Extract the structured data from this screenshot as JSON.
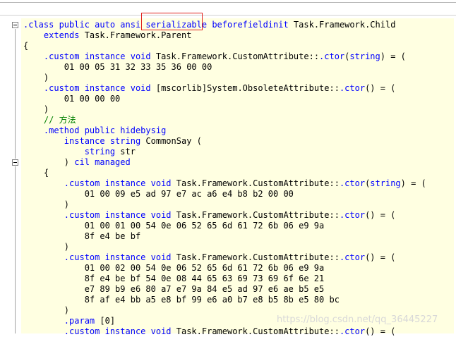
{
  "code_lines": [
    [
      {
        "t": ".class public auto ansi ",
        "c": "kw"
      },
      {
        "t": "serializable",
        "c": "kw"
      },
      {
        "t": " beforefieldinit ",
        "c": "kw"
      },
      {
        "t": "Task.Framework.Child",
        "c": "tx"
      }
    ],
    [
      {
        "t": "    ",
        "c": "tx"
      },
      {
        "t": "extends",
        "c": "kw"
      },
      {
        "t": " Task.Framework.Parent",
        "c": "tx"
      }
    ],
    [
      {
        "t": "{",
        "c": "tx"
      }
    ],
    [
      {
        "t": "    ",
        "c": "tx"
      },
      {
        "t": ".custom instance void",
        "c": "kw"
      },
      {
        "t": " Task.Framework.CustomAttribute::",
        "c": "tx"
      },
      {
        "t": ".ctor",
        "c": "kw"
      },
      {
        "t": "(",
        "c": "tx"
      },
      {
        "t": "string",
        "c": "kw"
      },
      {
        "t": ") = (",
        "c": "tx"
      }
    ],
    [
      {
        "t": "        01 00 05 31 32 33 35 36 00 00",
        "c": "tx"
      }
    ],
    [
      {
        "t": "    )",
        "c": "tx"
      }
    ],
    [
      {
        "t": "    ",
        "c": "tx"
      },
      {
        "t": ".custom instance void",
        "c": "kw"
      },
      {
        "t": " [mscorlib]System.ObsoleteAttribute::",
        "c": "tx"
      },
      {
        "t": ".ctor",
        "c": "kw"
      },
      {
        "t": "() = (",
        "c": "tx"
      }
    ],
    [
      {
        "t": "        01 00 00 00",
        "c": "tx"
      }
    ],
    [
      {
        "t": "    )",
        "c": "tx"
      }
    ],
    [
      {
        "t": "    // 方法",
        "c": "cm"
      }
    ],
    [
      {
        "t": "    ",
        "c": "tx"
      },
      {
        "t": ".method public hidebysig",
        "c": "kw"
      }
    ],
    [
      {
        "t": "        ",
        "c": "tx"
      },
      {
        "t": "instance string",
        "c": "kw"
      },
      {
        "t": " CommonSay (",
        "c": "tx"
      }
    ],
    [
      {
        "t": "            ",
        "c": "tx"
      },
      {
        "t": "string",
        "c": "kw"
      },
      {
        "t": " str",
        "c": "tx"
      }
    ],
    [
      {
        "t": "        ) ",
        "c": "tx"
      },
      {
        "t": "cil managed",
        "c": "kw"
      }
    ],
    [
      {
        "t": "    {",
        "c": "tx"
      }
    ],
    [
      {
        "t": "        ",
        "c": "tx"
      },
      {
        "t": ".custom instance void",
        "c": "kw"
      },
      {
        "t": " Task.Framework.CustomAttribute::",
        "c": "tx"
      },
      {
        "t": ".ctor",
        "c": "kw"
      },
      {
        "t": "(",
        "c": "tx"
      },
      {
        "t": "string",
        "c": "kw"
      },
      {
        "t": ") = (",
        "c": "tx"
      }
    ],
    [
      {
        "t": "            01 00 09 e5 ad 97 e7 ac a6 e4 b8 b2 00 00",
        "c": "tx"
      }
    ],
    [
      {
        "t": "        )",
        "c": "tx"
      }
    ],
    [
      {
        "t": "        ",
        "c": "tx"
      },
      {
        "t": ".custom instance void",
        "c": "kw"
      },
      {
        "t": " Task.Framework.CustomAttribute::",
        "c": "tx"
      },
      {
        "t": ".ctor",
        "c": "kw"
      },
      {
        "t": "() = (",
        "c": "tx"
      }
    ],
    [
      {
        "t": "            01 00 01 00 54 0e 06 52 65 6d 61 72 6b 06 e9 9a",
        "c": "tx"
      }
    ],
    [
      {
        "t": "            8f e4 be bf",
        "c": "tx"
      }
    ],
    [
      {
        "t": "        )",
        "c": "tx"
      }
    ],
    [
      {
        "t": "        ",
        "c": "tx"
      },
      {
        "t": ".custom instance void",
        "c": "kw"
      },
      {
        "t": " Task.Framework.CustomAttribute::",
        "c": "tx"
      },
      {
        "t": ".ctor",
        "c": "kw"
      },
      {
        "t": "() = (",
        "c": "tx"
      }
    ],
    [
      {
        "t": "            01 00 02 00 54 0e 06 52 65 6d 61 72 6b 06 e9 9a",
        "c": "tx"
      }
    ],
    [
      {
        "t": "            8f e4 be bf 54 0e 08 44 65 63 69 73 69 6f 6e 21",
        "c": "tx"
      }
    ],
    [
      {
        "t": "            e7 89 b9 e6 80 a7 e7 9a 84 e5 ad 97 e6 ae b5 e5",
        "c": "tx"
      }
    ],
    [
      {
        "t": "            8f af e4 bb a5 e8 bf 99 e6 a0 b7 e8 b5 8b e5 80 bc",
        "c": "tx"
      }
    ],
    [
      {
        "t": "        )",
        "c": "tx"
      }
    ],
    [
      {
        "t": "        ",
        "c": "tx"
      },
      {
        "t": ".param",
        "c": "kw"
      },
      {
        "t": " [0]",
        "c": "tx"
      }
    ],
    [
      {
        "t": "        ",
        "c": "tx"
      },
      {
        "t": ".custom instance void",
        "c": "kw"
      },
      {
        "t": " Task.Framework.CustomAttribute::",
        "c": "tx"
      },
      {
        "t": ".ctor",
        "c": "kw"
      },
      {
        "t": "() = (",
        "c": "tx"
      }
    ]
  ],
  "highlight_word": "serializable",
  "watermark": "https://blog.csdn.net/qq_36445227",
  "colors": {
    "keyword": "#0000ff",
    "comment": "#008000",
    "text": "#000000",
    "background": "#ffffe1",
    "highlight_box": "#e0201b"
  }
}
